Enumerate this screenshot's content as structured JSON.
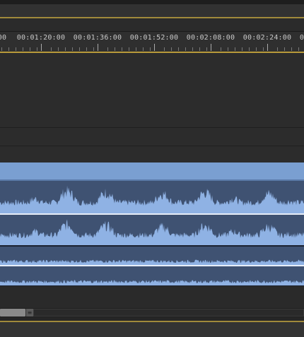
{
  "ruler": {
    "timecodes": [
      "00",
      "00:01:20:00",
      "00:01:36:00",
      "00:01:52:00",
      "00:02:08:00",
      "00:02:24:00",
      "0"
    ]
  },
  "clip": {
    "color": "#7a9fd1",
    "waveform_color": "#8fb2e4",
    "lane_color": "#3f5272"
  },
  "scrollbar": {
    "grip_icon": "grip-lines-icon",
    "grip_glyph": "≡"
  },
  "colors": {
    "accent_gold": "#a08a3b",
    "background": "#2a2a2a"
  }
}
